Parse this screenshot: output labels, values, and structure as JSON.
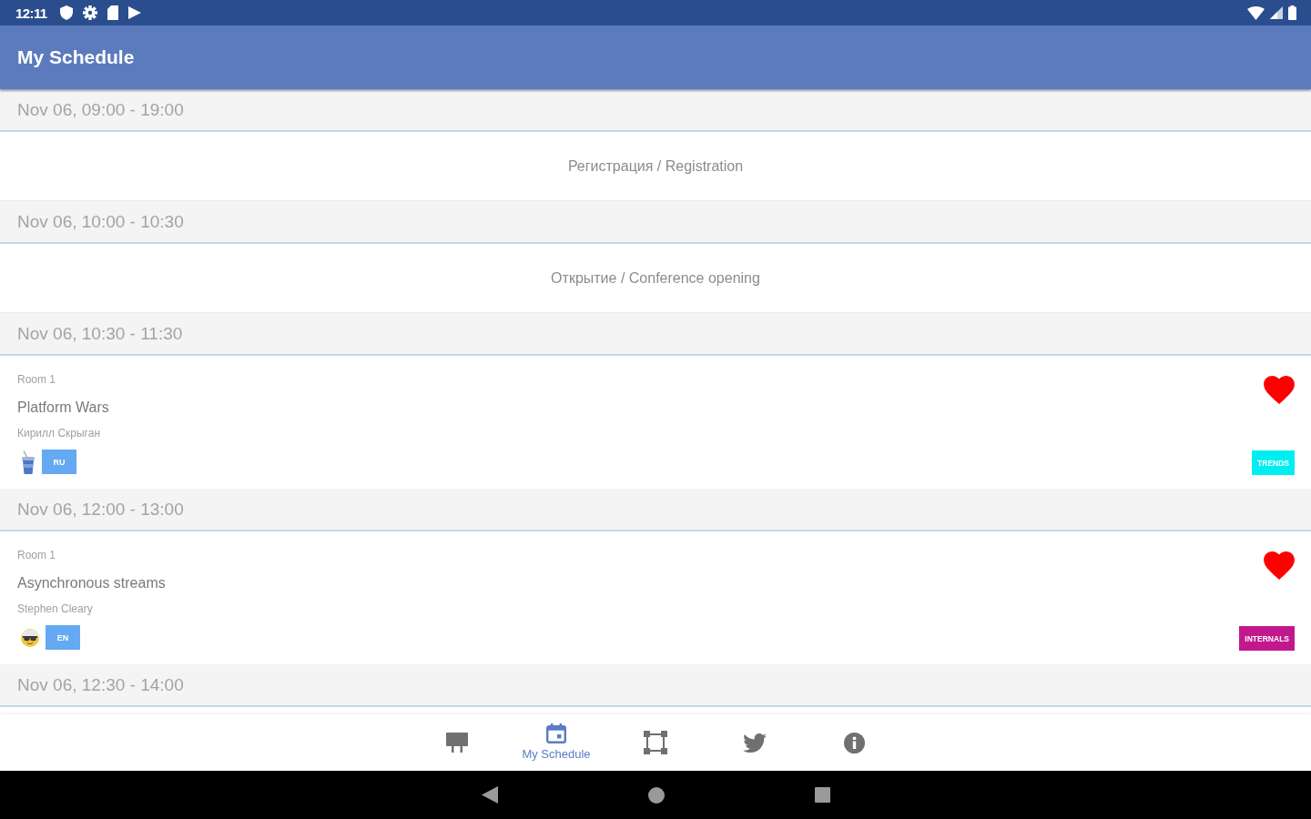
{
  "status_bar": {
    "time": "12:11"
  },
  "app_bar": {
    "title": "My Schedule"
  },
  "schedule": [
    {
      "time": "Nov 06, 09:00 - 19:00",
      "items": [
        {
          "kind": "general",
          "title": "Регистрация / Registration"
        }
      ]
    },
    {
      "time": "Nov 06, 10:00 - 10:30",
      "items": [
        {
          "kind": "general",
          "title": "Открытие / Conference opening"
        }
      ]
    },
    {
      "time": "Nov 06, 10:30 - 11:30",
      "items": [
        {
          "kind": "talk",
          "room": "Room 1",
          "title": "Platform Wars",
          "speaker": "Кирилл Скрыган",
          "badges": [
            {
              "kind": "cup"
            },
            {
              "kind": "language",
              "label": "RU"
            }
          ],
          "favorite": true,
          "tag": {
            "label": "TRENDS",
            "color": "#00eef0"
          }
        }
      ]
    },
    {
      "time": "Nov 06, 12:00 - 13:00",
      "items": [
        {
          "kind": "talk",
          "room": "Room 1",
          "title": "Asynchronous streams",
          "speaker": "Stephen Cleary",
          "badges": [
            {
              "kind": "face"
            },
            {
              "kind": "language",
              "label": "EN"
            }
          ],
          "favorite": true,
          "tag": {
            "label": "INTERNALS",
            "color": "#c2188e"
          }
        }
      ]
    },
    {
      "time": "Nov 06, 12:30 - 14:00"
    }
  ],
  "bottom_nav": {
    "items": [
      {
        "selected": false
      },
      {
        "label": "My Schedule",
        "selected": true
      },
      {
        "selected": false
      },
      {
        "selected": false
      },
      {
        "selected": false
      }
    ]
  }
}
